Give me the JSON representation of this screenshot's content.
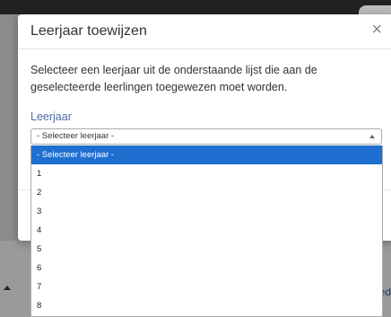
{
  "modal": {
    "title": "Leerjaar toewijzen",
    "close_glyph": "×",
    "instruction": "Selecteer een leerjaar uit de onderstaande lijst die aan de geselecteerde leerlingen toegewezen moet worden.",
    "field_label": "Leerjaar"
  },
  "select": {
    "current_value": "- Selecteer leerjaar -",
    "options": [
      "- Selecteer leerjaar -",
      "1",
      "2",
      "3",
      "4",
      "5",
      "6",
      "7",
      "8"
    ],
    "highlighted_index": 0
  },
  "background": {
    "edge_text": "ed"
  },
  "colors": {
    "highlight": "#1f6fd1",
    "label": "#4a6fa5"
  }
}
